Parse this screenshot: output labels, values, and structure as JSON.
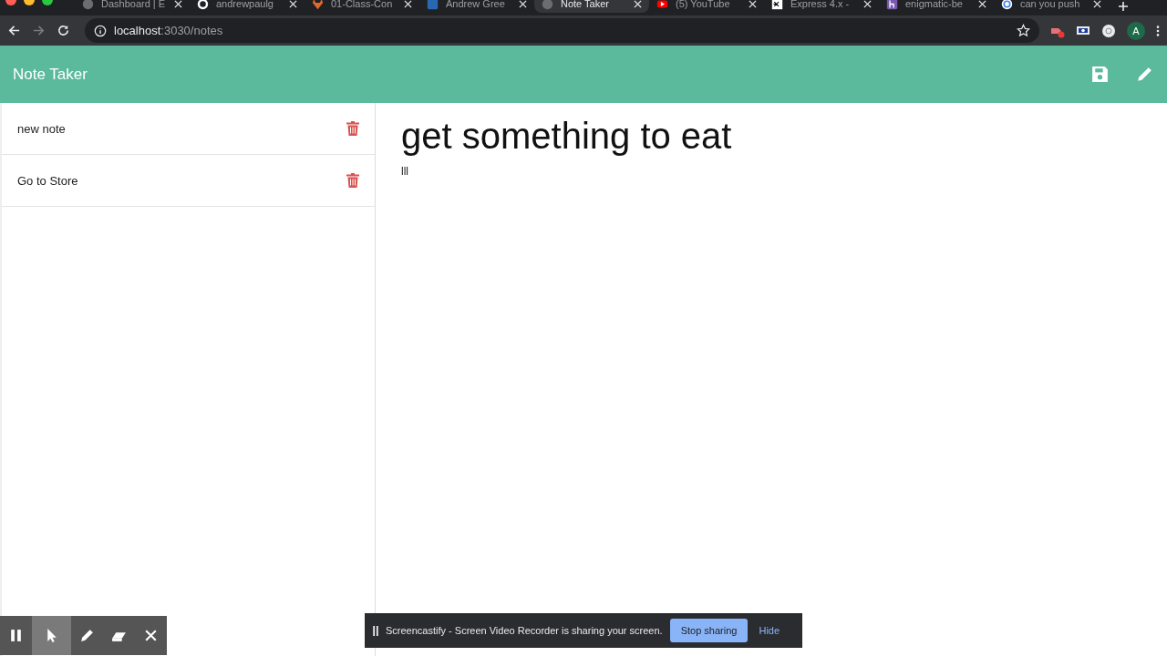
{
  "browser": {
    "tabs": [
      {
        "title": "Dashboard | E",
        "kind": "globe",
        "selected": false
      },
      {
        "title": "andrewpaulg",
        "kind": "github",
        "selected": false
      },
      {
        "title": "01-Class-Con",
        "kind": "gitlab",
        "selected": false
      },
      {
        "title": "Andrew Gree",
        "kind": "linkedin",
        "selected": false
      },
      {
        "title": "Note Taker",
        "kind": "globe",
        "selected": true
      },
      {
        "title": "(5) YouTube",
        "kind": "youtube",
        "selected": false
      },
      {
        "title": "Express 4.x -",
        "kind": "express",
        "selected": false
      },
      {
        "title": "enigmatic-be",
        "kind": "heroku",
        "selected": false
      },
      {
        "title": "can you push",
        "kind": "google",
        "selected": false
      }
    ],
    "url_host": "localhost",
    "url_path": ":3030/notes",
    "profile": "A"
  },
  "app": {
    "title": "Note Taker"
  },
  "notes": [
    {
      "title": "new note"
    },
    {
      "title": "Go to Store"
    }
  ],
  "editor": {
    "title": "get something to eat",
    "body": "lll"
  },
  "recorder_toolbar": {
    "tools": [
      {
        "kind": "pause",
        "selected": false
      },
      {
        "kind": "cursor",
        "selected": true
      },
      {
        "kind": "pen",
        "selected": false
      },
      {
        "kind": "eraser",
        "selected": false
      },
      {
        "kind": "close",
        "selected": false
      }
    ]
  },
  "share_bar": {
    "message": "Screencastify - Screen Video Recorder is sharing your screen.",
    "stop": "Stop sharing",
    "hide": "Hide"
  }
}
